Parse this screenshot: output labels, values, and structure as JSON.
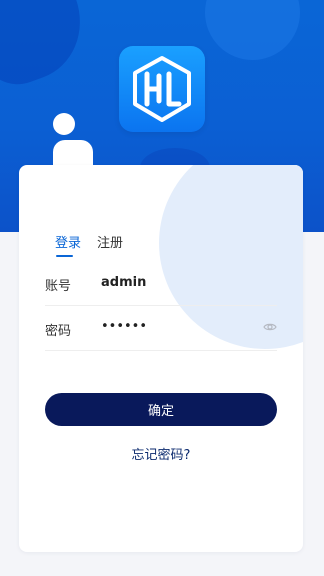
{
  "logo": {
    "text": "HL",
    "icon": "hl-hexagon-logo-icon"
  },
  "tabs": [
    {
      "label": "登录",
      "active": true
    },
    {
      "label": "注册",
      "active": false
    }
  ],
  "form": {
    "account": {
      "label": "账号",
      "value": "admin"
    },
    "password": {
      "label": "密码",
      "value": "••••••",
      "icon": "eye-icon"
    }
  },
  "actions": {
    "confirm_label": "确定",
    "forgot_label": "忘记密码?"
  },
  "colors": {
    "header": "#0a66d6",
    "accent": "#0a66d6",
    "button": "#09195b",
    "card_circle": "#e3edfb"
  }
}
